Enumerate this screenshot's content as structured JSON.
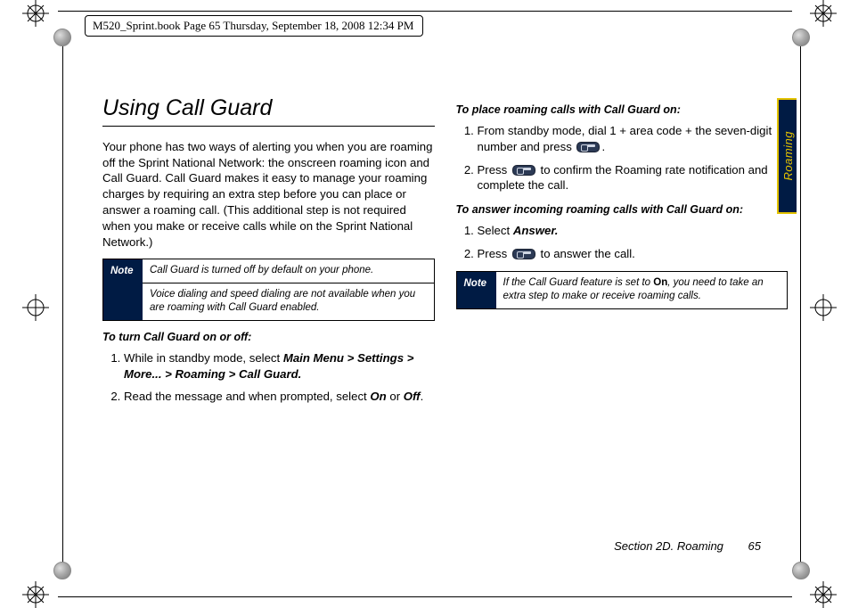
{
  "header": {
    "running_head": "M520_Sprint.book  Page 65  Thursday, September 18, 2008  12:34 PM"
  },
  "left": {
    "title": "Using Call Guard",
    "intro": "Your phone has two ways of alerting you when you are roaming off the Sprint National Network: the onscreen roaming icon and Call Guard. Call Guard makes it easy to manage your roaming charges by requiring an extra step before you can place or answer a roaming call. (This additional step is not required when you make or receive calls while on the Sprint National Network.)",
    "note_label": "Note",
    "note_line1": "Call Guard is turned off by default on your phone.",
    "note_line2": "Voice dialing and speed dialing are not available when you are roaming with Call Guard enabled.",
    "sub_turn": "To turn Call Guard on or off:",
    "step1_a": "While in standby mode, select ",
    "step1_b": "Main Menu > Settings > More... > Roaming > Call Guard.",
    "step2_a": "Read the message and when prompted, select ",
    "step2_on": "On",
    "step2_or": " or ",
    "step2_off": "Off",
    "step2_dot": "."
  },
  "right": {
    "sub_place": "To place roaming calls with Call Guard on:",
    "p_step1": "From standby mode, dial 1 + area code + the seven-digit number and press ",
    "p_step1_end": ".",
    "p_step2_a": "Press ",
    "p_step2_b": " to confirm the Roaming rate notification and complete the call.",
    "sub_answer": "To answer incoming roaming calls with Call Guard on:",
    "a_step1_a": "Select ",
    "a_step1_b": "Answer.",
    "a_step2_a": "Press ",
    "a_step2_b": " to answer the call.",
    "note_label": "Note",
    "note_text_a": "If the Call Guard feature is set to ",
    "note_text_on": "On",
    "note_text_b": ", you need to take an extra step to make or receive roaming calls."
  },
  "side_tab": "Roaming",
  "footer": {
    "section": "Section 2D. Roaming",
    "page": "65"
  }
}
